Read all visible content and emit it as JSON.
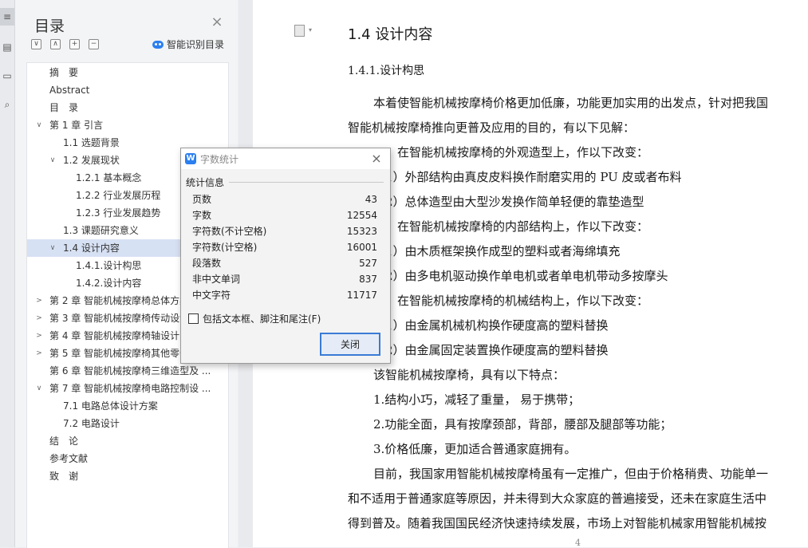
{
  "nav": {
    "title": "目录",
    "close_glyph": "×",
    "tools": [
      "∨",
      "∧",
      "+",
      "−"
    ],
    "smart_label": "智能识别目录",
    "items": [
      {
        "label": "摘　要",
        "level": 0,
        "arrow": ""
      },
      {
        "label": "Abstract",
        "level": 0,
        "arrow": ""
      },
      {
        "label": "目　录",
        "level": 0,
        "arrow": ""
      },
      {
        "label": "第 1 章  引言",
        "level": 0,
        "arrow": "v"
      },
      {
        "label": "1.1 选题背景",
        "level": 1,
        "arrow": ""
      },
      {
        "label": "1.2 发展现状",
        "level": 1,
        "arrow": "v"
      },
      {
        "label": "1.2.1 基本概念",
        "level": 2,
        "arrow": ""
      },
      {
        "label": "1.2.2 行业发展历程",
        "level": 2,
        "arrow": ""
      },
      {
        "label": "1.2.3 行业发展趋势",
        "level": 2,
        "arrow": ""
      },
      {
        "label": "1.3 课题研究意义",
        "level": 1,
        "arrow": ""
      },
      {
        "label": "1.4 设计内容",
        "level": 1,
        "arrow": "v",
        "selected": true
      },
      {
        "label": "1.4.1.设计构思",
        "level": 2,
        "arrow": ""
      },
      {
        "label": "1.4.2.设计内容",
        "level": 2,
        "arrow": ""
      },
      {
        "label": "第 2 章  智能机械按摩椅总体方案设计",
        "level": 0,
        "arrow": ">"
      },
      {
        "label": "第 3 章  智能机械按摩椅传动设计",
        "level": 0,
        "arrow": ">"
      },
      {
        "label": "第 4 章  智能机械按摩椅轴设计",
        "level": 0,
        "arrow": ">"
      },
      {
        "label": "第 5 章  智能机械按摩椅其他零件设计",
        "level": 0,
        "arrow": ">"
      },
      {
        "label": "第 6 章  智能机械按摩椅三维造型及 ...",
        "level": 0,
        "arrow": ""
      },
      {
        "label": "第 7 章  智能机械按摩椅电路控制设 ...",
        "level": 0,
        "arrow": "v"
      },
      {
        "label": "7.1 电路总体设计方案",
        "level": 1,
        "arrow": ""
      },
      {
        "label": "7.2 电路设计",
        "level": 1,
        "arrow": ""
      },
      {
        "label": "结　论",
        "level": 0,
        "arrow": ""
      },
      {
        "label": "参考文献",
        "level": 0,
        "arrow": ""
      },
      {
        "label": "致　谢",
        "level": 0,
        "arrow": ""
      }
    ]
  },
  "doc": {
    "heading": "1.4 设计内容",
    "subheading": "1.4.1.设计构思",
    "lines": [
      {
        "text": "本着使智能机械按摩椅价格更加低廉，功能更加实用的出发点，针对把我国",
        "indent": 1
      },
      {
        "text": "智能机械按摩椅推向更普及应用的目的，有以下见解：",
        "indent": 0
      },
      {
        "text": "一、在智能机械按摩椅的外观造型上，作以下改变：",
        "indent": 1
      },
      {
        "text": "（1）外部结构由真皮皮料换作耐磨实用的 PU 皮或者布料",
        "indent": 1
      },
      {
        "text": "（2）总体造型由大型沙发换作简单轻便的靠垫造型",
        "indent": 1
      },
      {
        "text": "二、在智能机械按摩椅的内部结构上，作以下改变：",
        "indent": 1
      },
      {
        "text": "（1）由木质框架换作成型的塑料或者海绵填充",
        "indent": 1
      },
      {
        "text": "（2）由多电机驱动换作单电机或者单电机带动多按摩头",
        "indent": 1
      },
      {
        "text": "三、在智能机械按摩椅的机械结构上，作以下改变：",
        "indent": 1
      },
      {
        "text": "（1）由金属机械机构换作硬度高的塑料替换",
        "indent": 1
      },
      {
        "text": "（2）由金属固定装置换作硬度高的塑料替换",
        "indent": 1
      },
      {
        "text": "该智能机械按摩椅，具有以下特点：",
        "indent": 1
      },
      {
        "text": "1.结构小巧，减轻了重量， 易于携带；",
        "indent": 1
      },
      {
        "text": "2.功能全面，具有按摩颈部，背部，腰部及腿部等功能；",
        "indent": 1
      },
      {
        "text": "3.价格低廉，更加适合普通家庭拥有。",
        "indent": 1
      },
      {
        "text": "目前，我国家用智能机械按摩椅虽有一定推广，但由于价格稍贵、功能单一",
        "indent": 1
      },
      {
        "text": "和不适用于普通家庭等原因，并未得到大众家庭的普遍接受，还未在家庭生活中",
        "indent": 0
      },
      {
        "text": "得到普及。随着我国国民经济快速持续发展，市场上对智能机械家用智能机械按",
        "indent": 0
      }
    ],
    "page_number": "4"
  },
  "dialog": {
    "title": "字数统计",
    "icon_letter": "W",
    "close_glyph": "×",
    "group_label": "统计信息",
    "stats": [
      {
        "key": "页数",
        "value": "43"
      },
      {
        "key": "字数",
        "value": "12554"
      },
      {
        "key": "字符数(不计空格)",
        "value": "15323"
      },
      {
        "key": "字符数(计空格)",
        "value": "16001"
      },
      {
        "key": "段落数",
        "value": "527"
      },
      {
        "key": "非中文单词",
        "value": "837"
      },
      {
        "key": "中文字符",
        "value": "11717"
      }
    ],
    "include_label": "包括文本框、脚注和尾注(F)",
    "close_button": "关闭"
  },
  "strip": {
    "icons": [
      "≡",
      "▤",
      "▭",
      "⌕"
    ]
  }
}
